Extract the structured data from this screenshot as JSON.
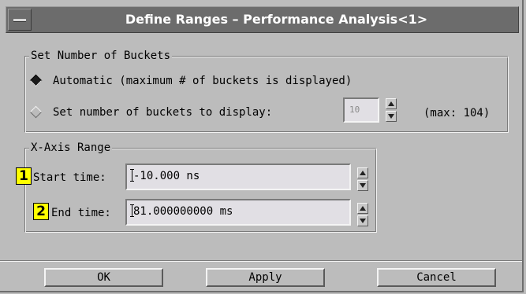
{
  "window": {
    "title": "Define Ranges – Performance Analysis<1>"
  },
  "buckets_group": {
    "label": "Set Number of Buckets",
    "automatic": {
      "label": "Automatic (maximum # of buckets is displayed)",
      "selected": true
    },
    "manual": {
      "label": "Set number of buckets to display:",
      "selected": false
    },
    "count_value": "10",
    "max_text": "(max: 104)"
  },
  "xaxis_group": {
    "label": "X-Axis Range",
    "start": {
      "callout": "1",
      "label": "Start time:",
      "value": "-10.000 ns"
    },
    "end": {
      "callout": "2",
      "label": "End time:",
      "value": "81.000000000 ms"
    }
  },
  "buttons": {
    "ok": "OK",
    "apply": "Apply",
    "cancel": "Cancel"
  }
}
